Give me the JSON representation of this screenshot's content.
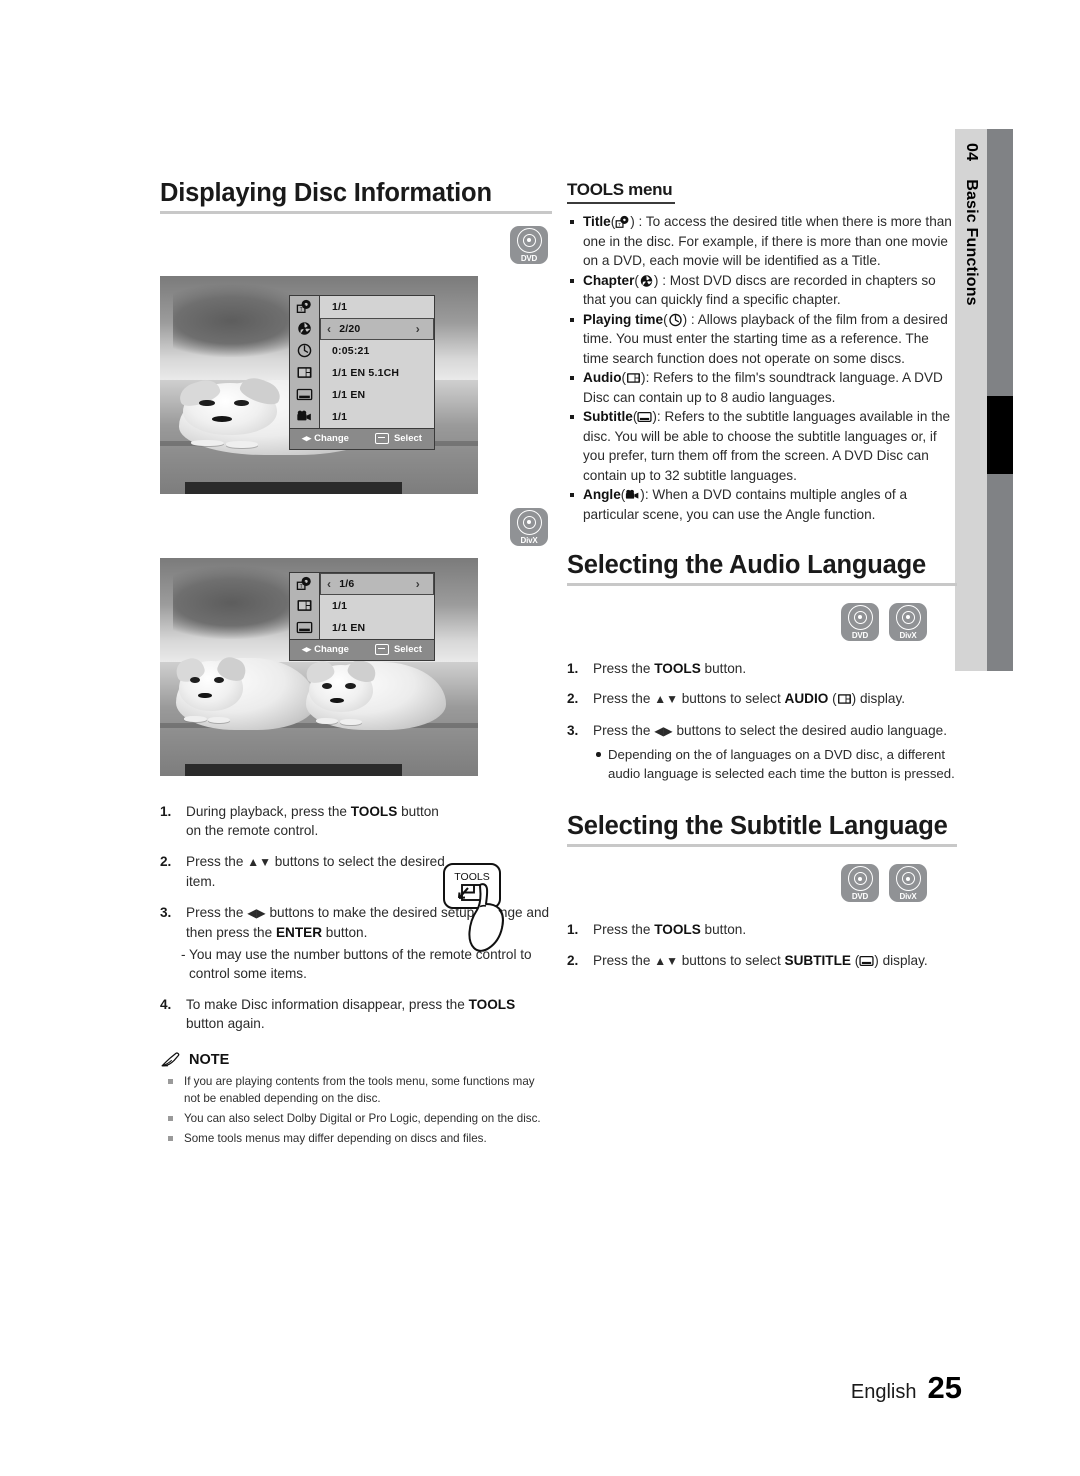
{
  "side_tab": {
    "chapter_number": "04",
    "chapter_name": "Basic Functions"
  },
  "left_column": {
    "heading": "Displaying Disc Information",
    "badge_dvd": "DVD",
    "badge_divx": "DivX",
    "osd_dvd": {
      "rows": [
        {
          "icon": "title-icon",
          "value": "1/1",
          "selected": false
        },
        {
          "icon": "chapter-icon",
          "value": "2/20",
          "selected": true
        },
        {
          "icon": "playing-time-icon",
          "value": "0:05:21",
          "selected": false
        },
        {
          "icon": "audio-icon",
          "value": "1/1 EN 5.1CH",
          "selected": false
        },
        {
          "icon": "subtitle-icon",
          "value": "1/1 EN",
          "selected": false
        },
        {
          "icon": "angle-icon",
          "value": "1/1",
          "selected": false
        }
      ],
      "footer_change": "Change",
      "footer_select": "Select"
    },
    "osd_divx": {
      "rows": [
        {
          "icon": "title-icon",
          "value": "1/6",
          "selected": true
        },
        {
          "icon": "audio-icon",
          "value": "1/1",
          "selected": false
        },
        {
          "icon": "subtitle-icon",
          "value": "1/1 EN",
          "selected": false
        }
      ],
      "footer_change": "Change",
      "footer_select": "Select"
    },
    "steps": [
      {
        "num": "1.",
        "parts": [
          {
            "t": "During playback, press the ",
            "b": false
          },
          {
            "t": "TOOLS",
            "b": true
          },
          {
            "t": " button on the remote control.",
            "b": false
          }
        ]
      },
      {
        "num": "2.",
        "parts": [
          {
            "t": "Press the ",
            "b": false
          },
          {
            "t": "▲▼",
            "b": false,
            "arrows": true
          },
          {
            "t": " buttons to select the desired item.",
            "b": false
          }
        ]
      },
      {
        "num": "3.",
        "parts": [
          {
            "t": "Press the ",
            "b": false
          },
          {
            "t": "◀▶",
            "b": false,
            "arrows": true
          },
          {
            "t": " buttons to make the desired setup change and then press the ",
            "b": false
          },
          {
            "t": "ENTER",
            "b": true
          },
          {
            "t": " button.",
            "b": false
          }
        ],
        "sub": "- You may use the number buttons of the remote control to control some items."
      },
      {
        "num": "4.",
        "parts": [
          {
            "t": "To make Disc information disappear, press the ",
            "b": false
          },
          {
            "t": "TOOLS",
            "b": true
          },
          {
            "t": " button again.",
            "b": false
          }
        ]
      }
    ],
    "tools_key_label": "TOOLS",
    "note": {
      "title": "NOTE",
      "items": [
        "If you are playing contents from the tools menu, some functions may not be enabled depending on the disc.",
        "You can also select Dolby Digital or Pro Logic, depending on the disc.",
        "Some tools menus may differ depending on discs and files."
      ]
    }
  },
  "right_column": {
    "tools_menu": {
      "heading": "TOOLS menu",
      "items": [
        {
          "label": "Title",
          "icon": "title-icon",
          "text": " : To access the desired title when there is more than one in the disc. For example, if there is more than one movie on a DVD, each movie will be identified as a Title."
        },
        {
          "label": "Chapter",
          "icon": "chapter-icon",
          "text": " : Most DVD discs are recorded in chapters so that you can quickly find a specific chapter."
        },
        {
          "label": "Playing time",
          "icon": "playing-time-icon",
          "text": " : Allows playback of the film from a desired time. You must enter the starting time as a reference. The time search function does not operate on some discs."
        },
        {
          "label": "Audio",
          "icon": "audio-icon",
          "text": ": Refers to the film's soundtrack language. A DVD Disc can contain up to 8 audio languages."
        },
        {
          "label": "Subtitle",
          "icon": "subtitle-icon",
          "text": ": Refers to the subtitle languages available in the disc. You will be able to choose the subtitle languages or, if you prefer, turn them off from the screen. A DVD Disc can contain up to 32 subtitle languages."
        },
        {
          "label": "Angle",
          "icon": "angle-icon",
          "text": ": When a DVD contains multiple angles of a particular scene, you can use the Angle function."
        }
      ]
    },
    "audio_section": {
      "heading": "Selecting the Audio Language",
      "badge_dvd": "DVD",
      "badge_divx": "DivX",
      "steps": [
        {
          "num": "1.",
          "parts": [
            {
              "t": "Press the ",
              "b": false
            },
            {
              "t": "TOOLS",
              "b": true
            },
            {
              "t": " button.",
              "b": false
            }
          ]
        },
        {
          "num": "2.",
          "parts": [
            {
              "t": "Press the ",
              "b": false
            },
            {
              "t": "▲▼",
              "b": false,
              "arrows": true
            },
            {
              "t": " buttons to select ",
              "b": false
            },
            {
              "t": "AUDIO",
              "b": true
            },
            {
              "t": " (",
              "b": false
            },
            {
              "t": "audio-icon",
              "icon": true
            },
            {
              "t": ") display.",
              "b": false
            }
          ]
        },
        {
          "num": "3.",
          "parts": [
            {
              "t": "Press the ",
              "b": false
            },
            {
              "t": "◀▶",
              "b": false,
              "arrows": true
            },
            {
              "t": " buttons to select the desired audio language.",
              "b": false
            }
          ]
        }
      ],
      "note_bullet": "Depending on the of languages on a DVD disc, a different audio language is selected each time the button is pressed."
    },
    "subtitle_section": {
      "heading": "Selecting the Subtitle Language",
      "badge_dvd": "DVD",
      "badge_divx": "DivX",
      "steps": [
        {
          "num": "1.",
          "parts": [
            {
              "t": "Press the ",
              "b": false
            },
            {
              "t": "TOOLS",
              "b": true
            },
            {
              "t": " button.",
              "b": false
            }
          ]
        },
        {
          "num": "2.",
          "parts": [
            {
              "t": "Press the ",
              "b": false
            },
            {
              "t": "▲▼",
              "b": false,
              "arrows": true
            },
            {
              "t": " buttons to select ",
              "b": false
            },
            {
              "t": "SUBTITLE",
              "b": true
            },
            {
              "t": " (",
              "b": false
            },
            {
              "t": "subtitle-icon",
              "icon": true
            },
            {
              "t": ") display.",
              "b": false
            }
          ]
        }
      ]
    }
  },
  "footer": {
    "language": "English",
    "page_number": "25"
  }
}
